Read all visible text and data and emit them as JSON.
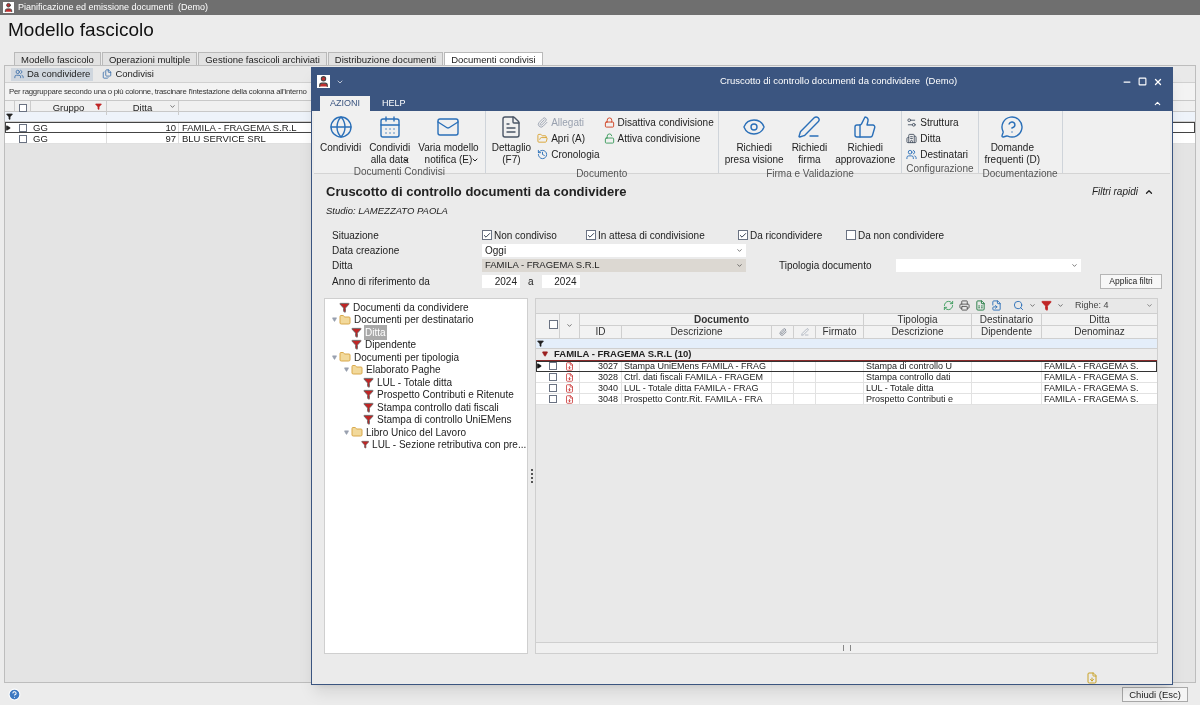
{
  "app": {
    "title": "Pianificazione ed emissione documenti  (Demo)",
    "heading": "Modello fascicolo",
    "tabs": [
      {
        "label": "Modello fascicolo",
        "selected": false
      },
      {
        "label": "Operazioni multiple",
        "selected": false
      },
      {
        "label": "Gestione fascicoli archiviati",
        "selected": false
      },
      {
        "label": "Distribuzione documenti",
        "selected": false
      },
      {
        "label": "Documenti condivisi",
        "selected": true
      }
    ],
    "subtabs": [
      {
        "label": "Da condividere",
        "selected": true
      },
      {
        "label": "Condivisi",
        "selected": false
      }
    ],
    "group_hint": "Per raggruppare secondo una o più colonne, trascinare l'intestazione della colonna all'interno",
    "grid": {
      "header_checked": false,
      "columns": [
        "Gruppo",
        "Ditta"
      ],
      "rows": [
        {
          "gruppo": "GG",
          "ditta": "10",
          "name": "FAMILA - FRAGEMA S.R.L",
          "checked": false,
          "selected": true
        },
        {
          "gruppo": "GG",
          "ditta": "97",
          "name": "BLU SERVICE SRL",
          "checked": false,
          "selected": false
        }
      ]
    },
    "close_button": "Chiudi (Esc)"
  },
  "dialog": {
    "title": "Cruscotto di controllo documenti da condividere  (Demo)",
    "ribbon_tabs": [
      {
        "label": "AZIONI",
        "selected": true
      },
      {
        "label": "HELP",
        "selected": false
      }
    ],
    "ribbon_groups": [
      {
        "label": "Documenti Condivisi",
        "items": [
          {
            "kind": "large",
            "label": "Condividi",
            "dropdown": false,
            "disabled": false
          },
          {
            "kind": "large",
            "label": "Condividi\nalla data",
            "dropdown": true,
            "disabled": false
          },
          {
            "kind": "large",
            "label": "Varia modello\nnotifica (E)",
            "dropdown": true,
            "disabled": false
          }
        ]
      },
      {
        "label": "Documento",
        "items": [
          {
            "kind": "large",
            "label": "Dettaglio\n(F7)",
            "dropdown": false,
            "disabled": false
          },
          {
            "kind": "small",
            "label": "Allegati",
            "disabled": true
          },
          {
            "kind": "small",
            "label": "Apri (A)",
            "disabled": false
          },
          {
            "kind": "small",
            "label": "Cronologia",
            "disabled": false
          },
          {
            "kind": "small",
            "label": "Disattiva condivisione",
            "disabled": false
          },
          {
            "kind": "small",
            "label": "Attiva condivisione",
            "disabled": false
          }
        ]
      },
      {
        "label": "Firma e Validazione",
        "items": [
          {
            "kind": "large",
            "label": "Richiedi\npresa visione",
            "dropdown": false,
            "disabled": false
          },
          {
            "kind": "large",
            "label": "Richiedi\nfirma",
            "dropdown": false,
            "disabled": false
          },
          {
            "kind": "large",
            "label": "Richiedi\napprovazione",
            "dropdown": false,
            "disabled": false
          }
        ]
      },
      {
        "label": "Configurazione",
        "items": [
          {
            "kind": "small",
            "label": "Struttura",
            "disabled": false
          },
          {
            "kind": "small",
            "label": "Ditta",
            "disabled": false
          },
          {
            "kind": "small",
            "label": "Destinatari",
            "disabled": false
          }
        ]
      },
      {
        "label": "Documentazione",
        "items": [
          {
            "kind": "large",
            "label": "Domande\nfrequenti (D)",
            "dropdown": false,
            "disabled": false
          }
        ]
      }
    ],
    "heading": "Cruscotto di controllo documenti da condividere",
    "studio": "Studio: LAMEZZATO PAOLA",
    "quick_filters": {
      "label": "Filtri rapidi",
      "expanded": true
    },
    "filters": {
      "situazione": {
        "label": "Situazione",
        "options": [
          {
            "label": "Non condiviso",
            "checked": true
          },
          {
            "label": "In attesa di condivisione",
            "checked": true
          },
          {
            "label": "Da ricondividere",
            "checked": true
          },
          {
            "label": "Da non condividere",
            "checked": false
          }
        ]
      },
      "data_creazione": {
        "label": "Data creazione",
        "value": "Oggi"
      },
      "ditta": {
        "label": "Ditta",
        "value": "FAMILA - FRAGEMA S.R.L"
      },
      "tipologia": {
        "label": "Tipologia documento"
      },
      "anno": {
        "label": "Anno di riferimento da",
        "from": "2024",
        "separator": "a",
        "to": "2024"
      },
      "apply_button": "Applica filtri"
    },
    "tree": [
      {
        "kind": "filter",
        "label": "Documenti da condividere",
        "selected": false
      },
      {
        "kind": "folder",
        "label": "Documenti per destinatario",
        "expanded": true,
        "selected": false,
        "children": [
          {
            "kind": "filter",
            "label": "Ditta",
            "selected": true
          },
          {
            "kind": "filter",
            "label": "Dipendente",
            "selected": false
          }
        ]
      },
      {
        "kind": "folder",
        "label": "Documenti per tipologia",
        "expanded": true,
        "selected": false,
        "children": [
          {
            "kind": "folder",
            "label": "Elaborato Paghe",
            "expanded": true,
            "selected": false,
            "children": [
              {
                "kind": "filter",
                "label": "LUL - Totale ditta",
                "selected": false
              },
              {
                "kind": "filter",
                "label": "Prospetto Contributi e Ritenute",
                "selected": false
              },
              {
                "kind": "filter",
                "label": "Stampa controllo dati fiscali",
                "selected": false
              },
              {
                "kind": "filter",
                "label": "Stampa di controllo UniEMens",
                "selected": false
              }
            ]
          },
          {
            "kind": "folder",
            "label": "Libro Unico del Lavoro",
            "expanded": true,
            "selected": false,
            "children": [
              {
                "kind": "filter",
                "label": "LUL - Sezione retributiva con pre...",
                "selected": false
              }
            ]
          }
        ]
      }
    ],
    "rows_selector": "Righe: 4",
    "grid": {
      "header_checked": false,
      "bands": [
        "Documento",
        "Tipologia",
        "Destinatario",
        "Ditta"
      ],
      "columns": [
        "ID",
        "Descrizione",
        "Firmato",
        "Descrizione",
        "Dipendente",
        "Denominaz"
      ],
      "group": {
        "label": "FAMILA - FRAGEMA S.R.L (10)",
        "expanded": true
      },
      "rows": [
        {
          "id": "3027",
          "descrizione": "Stampa UniEMens FAMILA - FRAG",
          "tipologia": "Stampa di controllo U",
          "ditta": "FAMILA - FRAGEMA S.",
          "checked": false,
          "selected": true
        },
        {
          "id": "3028",
          "descrizione": "Ctrl. dati fiscali FAMILA - FRAGEM",
          "tipologia": "Stampa controllo dati",
          "ditta": "FAMILA - FRAGEMA S.",
          "checked": false,
          "selected": false
        },
        {
          "id": "3040",
          "descrizione": "LUL - Totale ditta FAMILA - FRAG",
          "tipologia": "LUL - Totale ditta",
          "ditta": "FAMILA - FRAGEMA S.",
          "checked": false,
          "selected": false
        },
        {
          "id": "3048",
          "descrizione": "Prospetto Contr.Rit. FAMILA - FRA",
          "tipologia": "Prospetto Contributi e",
          "ditta": "FAMILA - FRAGEMA S.",
          "checked": false,
          "selected": false
        }
      ]
    }
  }
}
